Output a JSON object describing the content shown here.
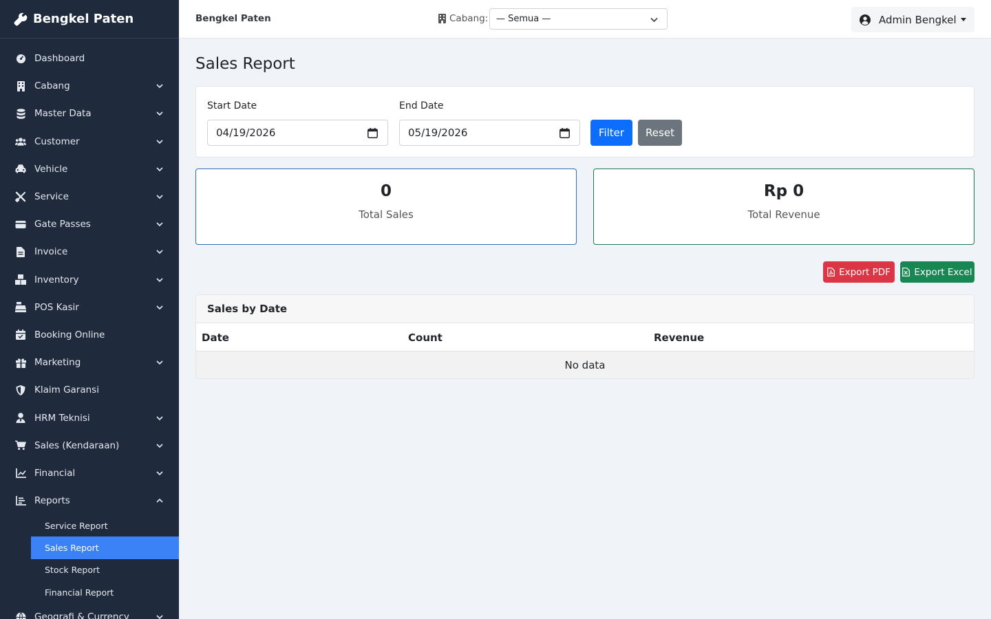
{
  "brand": {
    "name": "Bengkel Paten"
  },
  "sidebar": {
    "items": [
      {
        "label": "Dashboard",
        "icon": "dashboard-icon",
        "has_children": false
      },
      {
        "label": "Cabang",
        "icon": "building-icon",
        "has_children": true
      },
      {
        "label": "Master Data",
        "icon": "database-icon",
        "has_children": true
      },
      {
        "label": "Customer",
        "icon": "users-icon",
        "has_children": true
      },
      {
        "label": "Vehicle",
        "icon": "car-icon",
        "has_children": true
      },
      {
        "label": "Service",
        "icon": "tools-icon",
        "has_children": true
      },
      {
        "label": "Gate Passes",
        "icon": "gatepass-icon",
        "has_children": true
      },
      {
        "label": "Invoice",
        "icon": "file-invoice-icon",
        "has_children": true
      },
      {
        "label": "Inventory",
        "icon": "boxes-icon",
        "has_children": true
      },
      {
        "label": "POS Kasir",
        "icon": "cash-register-icon",
        "has_children": true
      },
      {
        "label": "Booking Online",
        "icon": "calendar-icon",
        "has_children": false
      },
      {
        "label": "Marketing",
        "icon": "gift-icon",
        "has_children": true
      },
      {
        "label": "Klaim Garansi",
        "icon": "shield-icon",
        "has_children": false
      },
      {
        "label": "HRM Teknisi",
        "icon": "user-tie-icon",
        "has_children": true
      },
      {
        "label": "Sales (Kendaraan)",
        "icon": "cart-icon",
        "has_children": true
      },
      {
        "label": "Financial",
        "icon": "chart-line-icon",
        "has_children": true
      },
      {
        "label": "Reports",
        "icon": "chart-bar-icon",
        "has_children": true,
        "expanded": true
      }
    ],
    "reports_sub": [
      {
        "label": "Service Report",
        "active": false
      },
      {
        "label": "Sales Report",
        "active": true
      },
      {
        "label": "Stock Report",
        "active": false
      },
      {
        "label": "Financial Report",
        "active": false
      }
    ],
    "last_item": {
      "label": "Geografi & Currency",
      "icon": "globe-icon"
    }
  },
  "topbar": {
    "title": "Bengkel Paten",
    "cabang_label": "Cabang:",
    "cabang_value": "— Semua —",
    "user_name": "Admin Bengkel"
  },
  "page": {
    "title": "Sales Report",
    "start_label": "Start Date",
    "start_value": "04/19/2026",
    "end_label": "End Date",
    "end_value": "05/19/2026",
    "filter_btn": "Filter",
    "reset_btn": "Reset"
  },
  "stats": {
    "total_sales_value": "0",
    "total_sales_label": "Total Sales",
    "total_revenue_value": "Rp 0",
    "total_revenue_label": "Total Revenue"
  },
  "export": {
    "pdf": "Export PDF",
    "excel": "Export Excel"
  },
  "table": {
    "title": "Sales by Date",
    "columns": [
      "Date",
      "Count",
      "Revenue"
    ],
    "empty_text": "No data"
  },
  "colors": {
    "sidebar_bg": "#1f2a3d",
    "active": "#3b82f6",
    "primary": "#0d6efd",
    "secondary": "#6c757d",
    "danger": "#dc3545",
    "success": "#198754"
  }
}
